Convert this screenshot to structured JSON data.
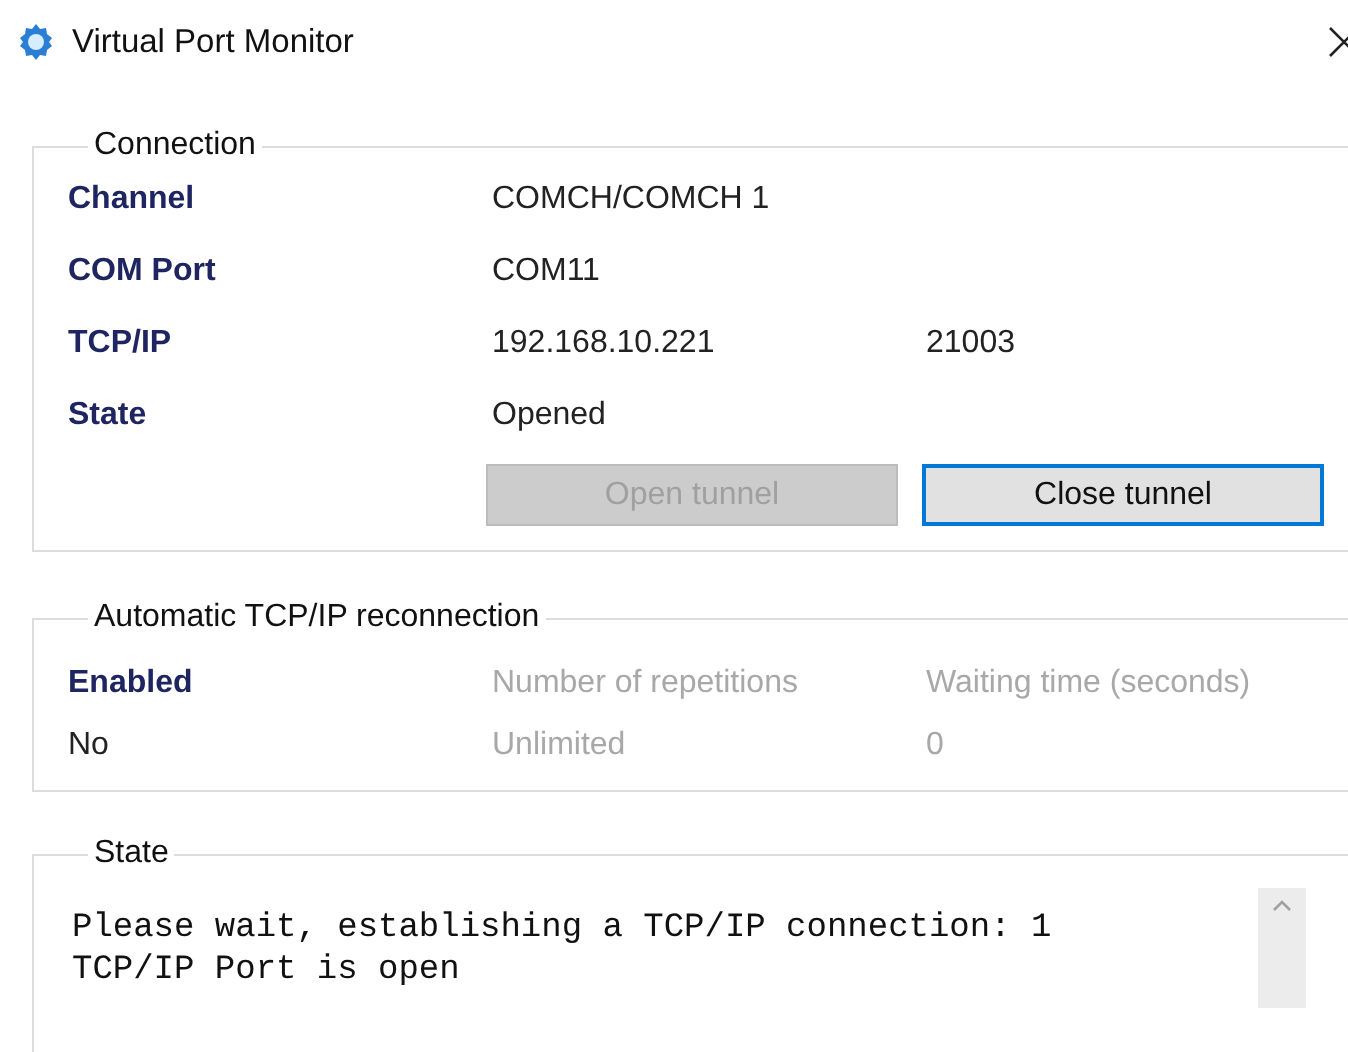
{
  "window": {
    "title": "Virtual Port Monitor"
  },
  "connection": {
    "title": "Connection",
    "rows": [
      {
        "label": "Channel",
        "values": [
          "COMCH/COMCH 1"
        ]
      },
      {
        "label": "COM Port",
        "values": [
          "COM11"
        ]
      },
      {
        "label": "TCP/IP",
        "values": [
          "192.168.10.221",
          "21003"
        ]
      },
      {
        "label": "State",
        "values": [
          "Opened"
        ]
      }
    ],
    "buttons": [
      {
        "label": "Open tunnel",
        "disabled": true,
        "focused": false
      },
      {
        "label": "Close tunnel",
        "disabled": false,
        "focused": true
      }
    ]
  },
  "reconnection": {
    "title": "Automatic TCP/IP reconnection",
    "columns": [
      {
        "header": "Enabled",
        "value": "No",
        "disabled": false
      },
      {
        "header": "Number of repetitions",
        "value": "Unlimited",
        "disabled": true
      },
      {
        "header": "Waiting time (seconds)",
        "value": "0",
        "disabled": true
      }
    ]
  },
  "state": {
    "title": "State",
    "lines": [
      "Please wait, establishing a TCP/IP connection: 1",
      "TCP/IP Port is open"
    ]
  }
}
